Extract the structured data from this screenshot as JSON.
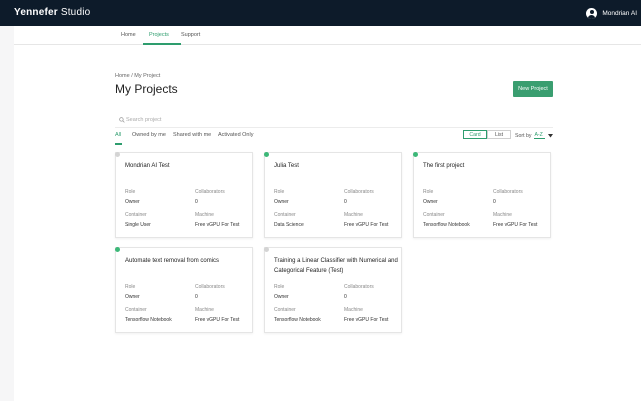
{
  "app": {
    "brand": "Yennefer",
    "product": "Studio",
    "user_name": "Mondrian AI"
  },
  "nav": [
    {
      "label": "Home"
    },
    {
      "label": "Projects"
    },
    {
      "label": "Support"
    }
  ],
  "breadcrumb": {
    "home": "Home",
    "sep": "/",
    "current": "My Project"
  },
  "page_title": "My Projects",
  "new_project_label": "New Project",
  "search_placeholder": "Search project",
  "filters": [
    {
      "label": "All"
    },
    {
      "label": "Owned by me"
    },
    {
      "label": "Shared with me"
    },
    {
      "label": "Activated Only"
    }
  ],
  "view": {
    "card": "Card",
    "list": "List"
  },
  "sort": {
    "label": "Sort by",
    "value": "A-Z"
  },
  "labels": {
    "role": "Role",
    "collaborators": "Collaborators",
    "container": "Container",
    "machine": "Machine"
  },
  "colors": {
    "accent": "#2e9d6e",
    "active_dot": "#3cb878",
    "inactive_dot": "#d4d4d4",
    "topbar": "#0d1b2a"
  },
  "projects": [
    {
      "name": "Mondrian AI Test",
      "active": false,
      "role": "Owner",
      "collaborators": "0",
      "container": "Single User",
      "machine": "Free vGPU For Test"
    },
    {
      "name": "Julia Test",
      "active": true,
      "role": "Owner",
      "collaborators": "0",
      "container": "Data Science",
      "machine": "Free vGPU For Test"
    },
    {
      "name": "The first project",
      "active": true,
      "role": "Owner",
      "collaborators": "0",
      "container": "Tensorflow Notebook",
      "machine": "Free vGPU For Test"
    },
    {
      "name": "Automate text removal from comics",
      "active": true,
      "role": "Owner",
      "collaborators": "0",
      "container": "Tensorflow Notebook",
      "machine": "Free vGPU For Test"
    },
    {
      "name": "Training a Linear Classifier with Numerical and Categorical Feature (Test)",
      "active": false,
      "role": "Owner",
      "collaborators": "0",
      "container": "Tensorflow Notebook",
      "machine": "Free vGPU For Test"
    }
  ]
}
